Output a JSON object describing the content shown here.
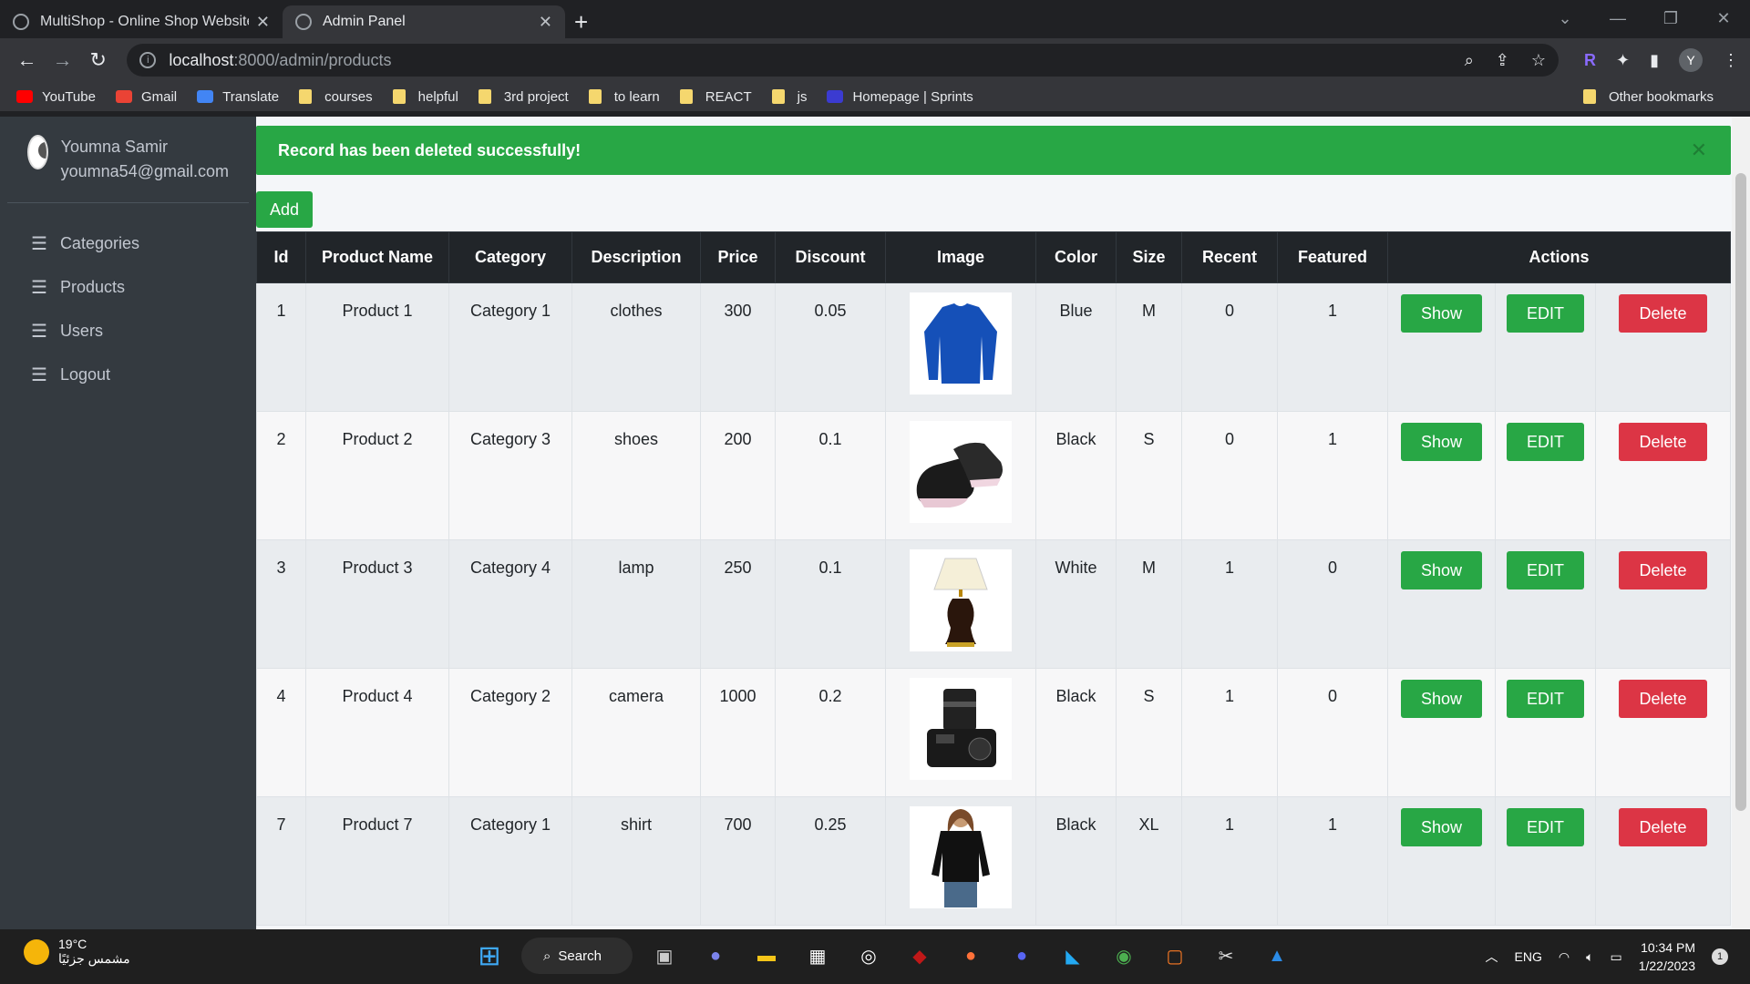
{
  "browser": {
    "tabs": [
      {
        "title": "MultiShop - Online Shop Website",
        "active": false
      },
      {
        "title": "Admin Panel",
        "active": true
      }
    ],
    "url_host": "localhost",
    "url_path": ":8000/admin/products",
    "bookmarks": [
      {
        "label": "YouTube",
        "icon": "youtube-icon"
      },
      {
        "label": "Gmail",
        "icon": "gmail-icon"
      },
      {
        "label": "Translate",
        "icon": "translate-icon"
      },
      {
        "label": "courses",
        "icon": "folder-icon"
      },
      {
        "label": "helpful",
        "icon": "folder-icon"
      },
      {
        "label": "3rd project",
        "icon": "folder-icon"
      },
      {
        "label": "to learn",
        "icon": "folder-icon"
      },
      {
        "label": "REACT",
        "icon": "folder-icon"
      },
      {
        "label": "js",
        "icon": "folder-icon"
      },
      {
        "label": "Homepage | Sprints",
        "icon": "sprints-icon"
      }
    ],
    "other_bookmarks": "Other bookmarks",
    "profile_initial": "Y"
  },
  "sidebar": {
    "user_name": "Youmna Samir",
    "user_email": "youmna54@gmail.com",
    "items": [
      {
        "label": "Categories"
      },
      {
        "label": "Products"
      },
      {
        "label": "Users"
      },
      {
        "label": "Logout"
      }
    ]
  },
  "alert": {
    "message": "Record has been deleted successfully!"
  },
  "add_label": "Add",
  "table": {
    "headers": [
      "Id",
      "Product Name",
      "Category",
      "Description",
      "Price",
      "Discount",
      "Image",
      "Color",
      "Size",
      "Recent",
      "Featured",
      "Actions"
    ],
    "rows": [
      {
        "id": "1",
        "name": "Product 1",
        "category": "Category 1",
        "description": "clothes",
        "price": "300",
        "discount": "0.05",
        "image": "sweater",
        "color": "Blue",
        "size": "M",
        "recent": "0",
        "featured": "1"
      },
      {
        "id": "2",
        "name": "Product 2",
        "category": "Category 3",
        "description": "shoes",
        "price": "200",
        "discount": "0.1",
        "image": "shoes",
        "color": "Black",
        "size": "S",
        "recent": "0",
        "featured": "1"
      },
      {
        "id": "3",
        "name": "Product 3",
        "category": "Category 4",
        "description": "lamp",
        "price": "250",
        "discount": "0.1",
        "image": "lamp",
        "color": "White",
        "size": "M",
        "recent": "1",
        "featured": "0"
      },
      {
        "id": "4",
        "name": "Product 4",
        "category": "Category 2",
        "description": "camera",
        "price": "1000",
        "discount": "0.2",
        "image": "camera",
        "color": "Black",
        "size": "S",
        "recent": "1",
        "featured": "0"
      },
      {
        "id": "7",
        "name": "Product 7",
        "category": "Category 1",
        "description": "shirt",
        "price": "700",
        "discount": "0.25",
        "image": "shirt",
        "color": "Black",
        "size": "XL",
        "recent": "1",
        "featured": "1"
      }
    ],
    "action_labels": {
      "show": "Show",
      "edit": "EDIT",
      "delete": "Delete"
    }
  },
  "taskbar": {
    "temperature": "19°C",
    "weather_text": "مشمس جزئيًا",
    "search_label": "Search",
    "language": "ENG",
    "time": "10:34 PM",
    "date": "1/22/2023",
    "notification_count": "1"
  }
}
